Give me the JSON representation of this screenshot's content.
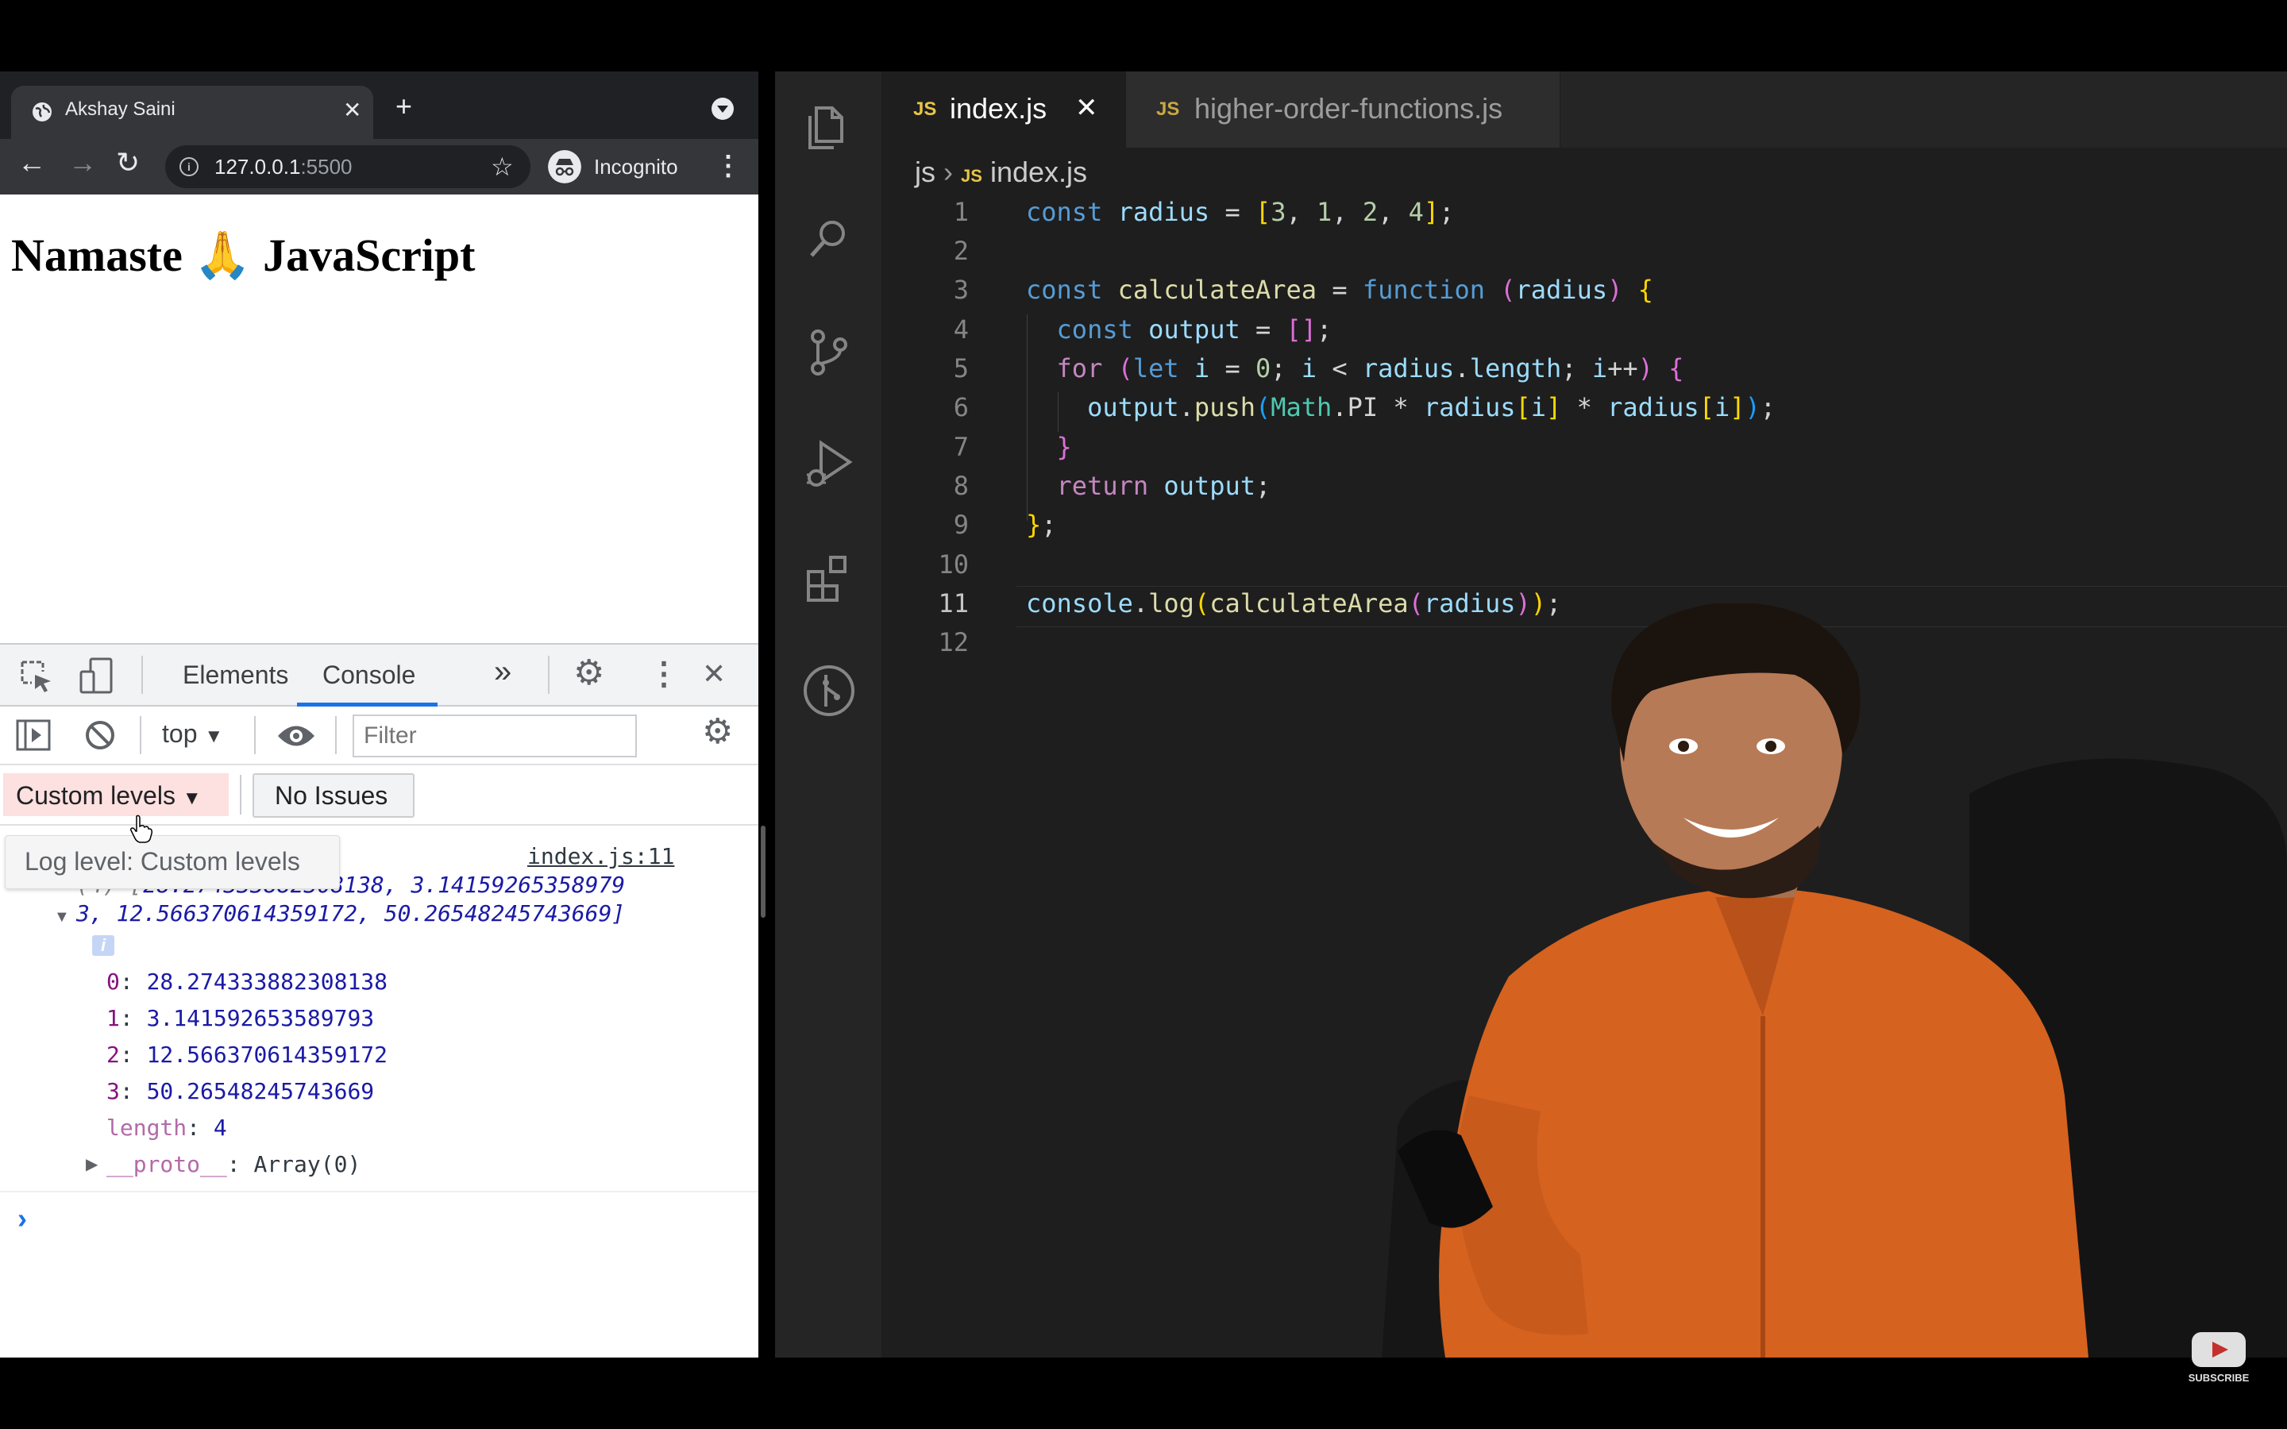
{
  "browser": {
    "tab_title": "Akshay Saini",
    "url_host": "127.0.0.1",
    "url_port": ":5500",
    "incognito_label": "Incognito",
    "page_heading_1": "Namaste",
    "page_heading_emoji": "🙏",
    "page_heading_2": "JavaScript"
  },
  "devtools": {
    "tabs": [
      "Elements",
      "Console"
    ],
    "more": "»",
    "context": "top",
    "filter_placeholder": "Filter",
    "levels_label": "Custom levels",
    "issues_label": "No Issues",
    "tooltip": "Log level: Custom levels",
    "source_link": "index.js:11",
    "summary_line1_prefix": "(4) [",
    "summary_line1": "28.274333882308138, 3.14159265358979",
    "summary_line2": "3, 12.566370614359172, 50.26548245743669]",
    "info_badge": "i",
    "entries": [
      {
        "key": "0",
        "value": "28.274333882308138"
      },
      {
        "key": "1",
        "value": "3.141592653589793"
      },
      {
        "key": "2",
        "value": "12.566370614359172"
      },
      {
        "key": "3",
        "value": "50.26548245743669"
      }
    ],
    "length_key": "length",
    "length_value": "4",
    "proto_key": "__proto__",
    "proto_value": "Array(0)",
    "prompt": "›"
  },
  "editor": {
    "tabs": [
      {
        "icon": "JS",
        "name": "index.js",
        "close": "✕"
      },
      {
        "icon": "JS",
        "name": "higher-order-functions.js"
      }
    ],
    "breadcrumb_folder": "js",
    "breadcrumb_sep": "›",
    "breadcrumb_icon": "JS",
    "breadcrumb_file": "index.js",
    "line_numbers": [
      "1",
      "2",
      "3",
      "4",
      "5",
      "6",
      "7",
      "8",
      "9",
      "10",
      "11",
      "12"
    ],
    "current_line": "11"
  },
  "youtube": {
    "subscribe_label": "SUBSCRIBE"
  },
  "colors": {
    "keyword": "#569cd6",
    "control": "#c586c0",
    "variable": "#9cdcfe",
    "function": "#dcdcaa",
    "number": "#b5cea8",
    "class": "#4ec9b0",
    "bracket_yellow": "#ffd700",
    "bracket_pink": "#da70d6",
    "bracket_blue": "#179fff",
    "console_blue": "#1a1aa6",
    "console_purple": "#881280"
  }
}
